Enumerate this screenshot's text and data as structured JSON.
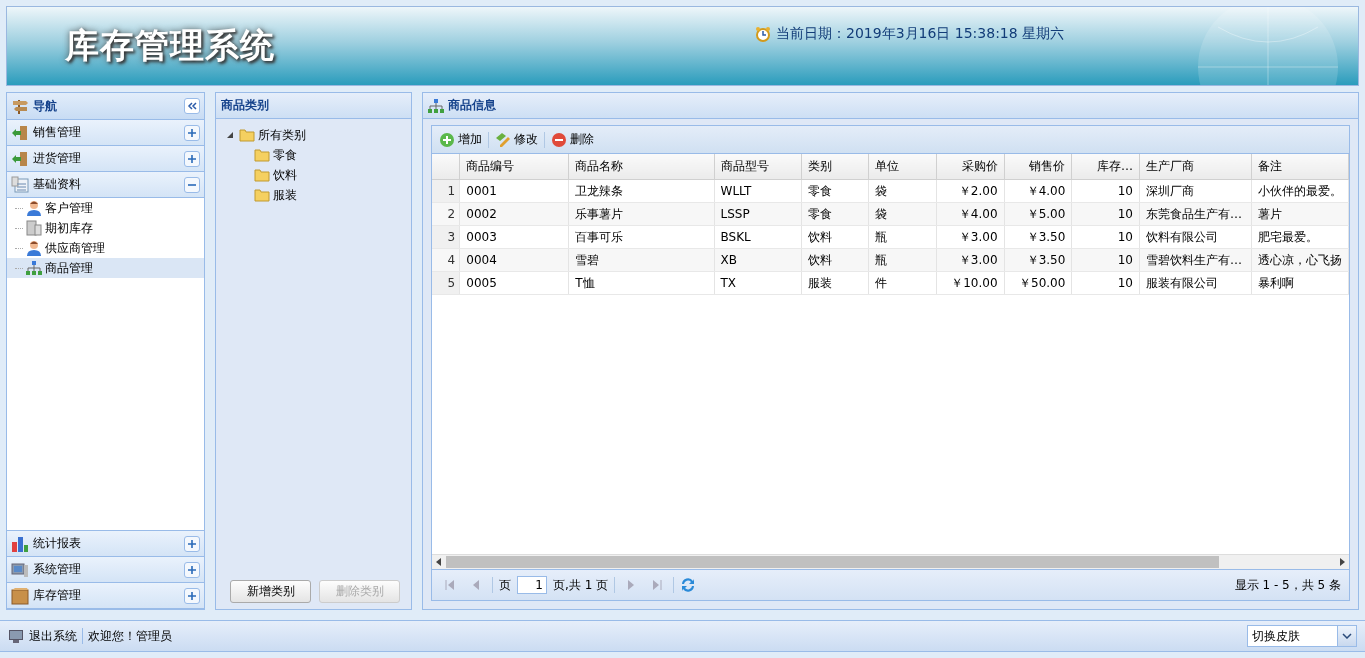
{
  "header": {
    "title": "库存管理系统",
    "date_text": "当前日期：2019年3月16日 15:38:18 星期六"
  },
  "nav": {
    "title": "导航",
    "sections": [
      {
        "label": "销售管理",
        "expanded": false
      },
      {
        "label": "进货管理",
        "expanded": false
      },
      {
        "label": "基础资料",
        "expanded": true,
        "children": [
          {
            "label": "客户管理",
            "selected": false
          },
          {
            "label": "期初库存",
            "selected": false
          },
          {
            "label": "供应商管理",
            "selected": false
          },
          {
            "label": "商品管理",
            "selected": true
          }
        ]
      },
      {
        "label": "统计报表",
        "expanded": false
      },
      {
        "label": "系统管理",
        "expanded": false
      },
      {
        "label": "库存管理",
        "expanded": false
      }
    ]
  },
  "category_panel": {
    "title": "商品类别",
    "tree": [
      {
        "label": "所有类别",
        "expanded": true,
        "children": [
          {
            "label": "零食"
          },
          {
            "label": "饮料"
          },
          {
            "label": "服装"
          }
        ]
      }
    ],
    "buttons": [
      {
        "label": "新增类别",
        "disabled": false
      },
      {
        "label": "删除类别",
        "disabled": true
      }
    ]
  },
  "goods_panel": {
    "title": "商品信息",
    "toolbar": [
      {
        "label": "增加",
        "kind": "add"
      },
      {
        "label": "修改",
        "kind": "edit"
      },
      {
        "label": "删除",
        "kind": "remove"
      }
    ],
    "table": {
      "columns": [
        "商品编号",
        "商品名称",
        "商品型号",
        "类别",
        "单位",
        "采购价",
        "销售价",
        "库存…",
        "生产厂商",
        "备注"
      ],
      "rows": [
        {
          "num": "1",
          "cells": [
            "0001",
            "卫龙辣条",
            "WLLT",
            "零食",
            "袋",
            "￥2.00",
            "￥4.00",
            "10",
            "深圳厂商",
            "小伙伴的最爱。"
          ]
        },
        {
          "num": "2",
          "cells": [
            "0002",
            "乐事薯片",
            "LSSP",
            "零食",
            "袋",
            "￥4.00",
            "￥5.00",
            "10",
            "东莞食品生产有…",
            "薯片"
          ]
        },
        {
          "num": "3",
          "cells": [
            "0003",
            "百事可乐",
            "BSKL",
            "饮料",
            "瓶",
            "￥3.00",
            "￥3.50",
            "10",
            "饮料有限公司",
            "肥宅最爱。"
          ]
        },
        {
          "num": "4",
          "cells": [
            "0004",
            "雪碧",
            "XB",
            "饮料",
            "瓶",
            "￥3.00",
            "￥3.50",
            "10",
            "雪碧饮料生产有…",
            "透心凉，心飞扬"
          ]
        },
        {
          "num": "5",
          "cells": [
            "0005",
            "T恤",
            "TX",
            "服装",
            "件",
            "￥10.00",
            "￥50.00",
            "10",
            "服装有限公司",
            "暴利啊"
          ]
        }
      ]
    },
    "pager": {
      "page_label": "页",
      "page_value": "1",
      "page_total": "页,共 1 页",
      "summary": "显示 1 - 5，共 5 条"
    }
  },
  "footer": {
    "logout": "退出系统",
    "welcome": "欢迎您！管理员",
    "skin_select": "切换皮肤"
  }
}
